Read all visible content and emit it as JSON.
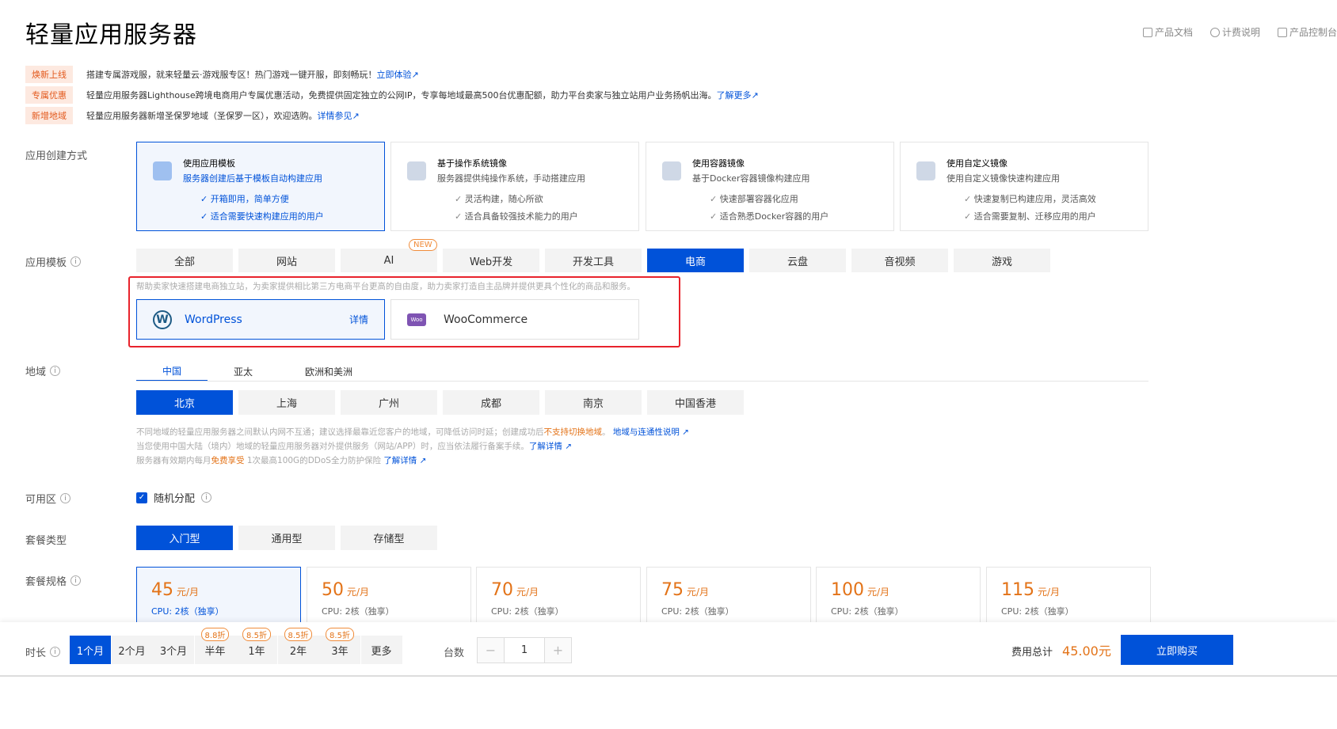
{
  "page": {
    "title": "轻量应用服务器"
  },
  "top_links": [
    {
      "label": "产品文档",
      "icon": "doc-icon"
    },
    {
      "label": "计费说明",
      "icon": "help-circle-icon"
    },
    {
      "label": "产品控制台",
      "icon": "grid-icon"
    }
  ],
  "notices": [
    {
      "tag": "焕新上线",
      "text": "搭建专属游戏服，就来轻量云·游戏服专区！热门游戏一键开服，即刻畅玩！",
      "link": "立即体验"
    },
    {
      "tag": "专属优惠",
      "text": "轻量应用服务器Lighthouse跨境电商用户专属优惠活动，免费提供固定独立的公网IP，专享每地域最高500台优惠配额，助力平台卖家与独立站用户业务扬帆出海。",
      "link": "了解更多"
    },
    {
      "tag": "新增地域",
      "text": "轻量应用服务器新增圣保罗地域（圣保罗一区），欢迎选购。",
      "link": "详情参见"
    }
  ],
  "creation": {
    "label": "应用创建方式",
    "cards": [
      {
        "title": "使用应用模板",
        "subtitle": "服务器创建后基于模板自动构建应用",
        "items": [
          "开箱即用，简单方便",
          "适合需要快速构建应用的用户"
        ],
        "selected": true
      },
      {
        "title": "基于操作系统镜像",
        "subtitle": "服务器提供纯操作系统，手动搭建应用",
        "items": [
          "灵活构建，随心所欲",
          "适合具备较强技术能力的用户"
        ],
        "selected": false
      },
      {
        "title": "使用容器镜像",
        "subtitle": "基于Docker容器镜像构建应用",
        "items": [
          "快速部署容器化应用",
          "适合熟悉Docker容器的用户"
        ],
        "selected": false
      },
      {
        "title": "使用自定义镜像",
        "subtitle": "使用自定义镜像快速构建应用",
        "items": [
          "快速复制已构建应用，灵活高效",
          "适合需要复制、迁移应用的用户"
        ],
        "selected": false
      }
    ]
  },
  "template": {
    "label": "应用模板",
    "tabs": [
      "全部",
      "网站",
      "AI",
      "Web开发",
      "开发工具",
      "电商",
      "云盘",
      "音视频",
      "游戏"
    ],
    "active_tab": 5,
    "ai_badge": "NEW",
    "description": "帮助卖家快速搭建电商独立站，为卖家提供相比第三方电商平台更高的自由度，助力卖家打造自主品牌并提供更具个性化的商品和服务。",
    "items": [
      {
        "name": "WordPress",
        "detail": "详情",
        "selected": true
      },
      {
        "name": "WooCommerce",
        "selected": false
      }
    ]
  },
  "region": {
    "label": "地域",
    "tabs": [
      "中国",
      "亚太",
      "欧洲和美洲"
    ],
    "cities": [
      "北京",
      "上海",
      "广州",
      "成都",
      "南京",
      "中国香港"
    ],
    "note1_a": "不同地域的轻量应用服务器之间默认内网不互通；建议选择最靠近您客户的地域，可降低访问时延；创建成功后",
    "note1_b": "不支持切换地域",
    "note1_c": "。",
    "note1_link": "地域与连通性说明",
    "note2": "当您使用中国大陆（境内）地域的轻量应用服务器对外提供服务（网站/APP）时，应当依法履行备案手续。",
    "note2_link": "了解详情",
    "note3_a": "服务器有效期内每月",
    "note3_b": "免费享受",
    "note3_c": " 1次最高100G的DDoS全力防护保险",
    "note3_link": "了解详情"
  },
  "zone": {
    "label": "可用区",
    "option": "随机分配",
    "checked": true
  },
  "plan_type": {
    "label": "套餐类型",
    "options": [
      "入门型",
      "通用型",
      "存储型"
    ]
  },
  "plan_spec": {
    "label": "套餐规格",
    "unit": "元/月",
    "cards": [
      {
        "price": "45",
        "cpu": "CPU: 2核（独享）",
        "selected": true
      },
      {
        "price": "50",
        "cpu": "CPU: 2核（独享）"
      },
      {
        "price": "70",
        "cpu": "CPU: 2核（独享）"
      },
      {
        "price": "75",
        "cpu": "CPU: 2核（独享）"
      },
      {
        "price": "100",
        "cpu": "CPU: 2核（独享）"
      },
      {
        "price": "115",
        "cpu": "CPU: 2核（独享）"
      }
    ]
  },
  "footer": {
    "duration_label": "时长",
    "durations": [
      {
        "label": "1个月",
        "discount": ""
      },
      {
        "label": "2个月",
        "discount": ""
      },
      {
        "label": "3个月",
        "discount": ""
      },
      {
        "label": "半年",
        "discount": "8.8折"
      },
      {
        "label": "1年",
        "discount": "8.5折"
      },
      {
        "label": "2年",
        "discount": "8.5折"
      },
      {
        "label": "3年",
        "discount": "8.5折"
      },
      {
        "label": "更多",
        "discount": ""
      }
    ],
    "qty_label": "台数",
    "qty": "1",
    "minus": "−",
    "plus": "+",
    "total_label": "费用总计",
    "total": "45.00元",
    "buy": "立即购买"
  },
  "colors": {
    "accent": "#0052d9",
    "orange": "#e37318",
    "tag_bg": "#fde9e0",
    "red_box": "#e8232c"
  }
}
